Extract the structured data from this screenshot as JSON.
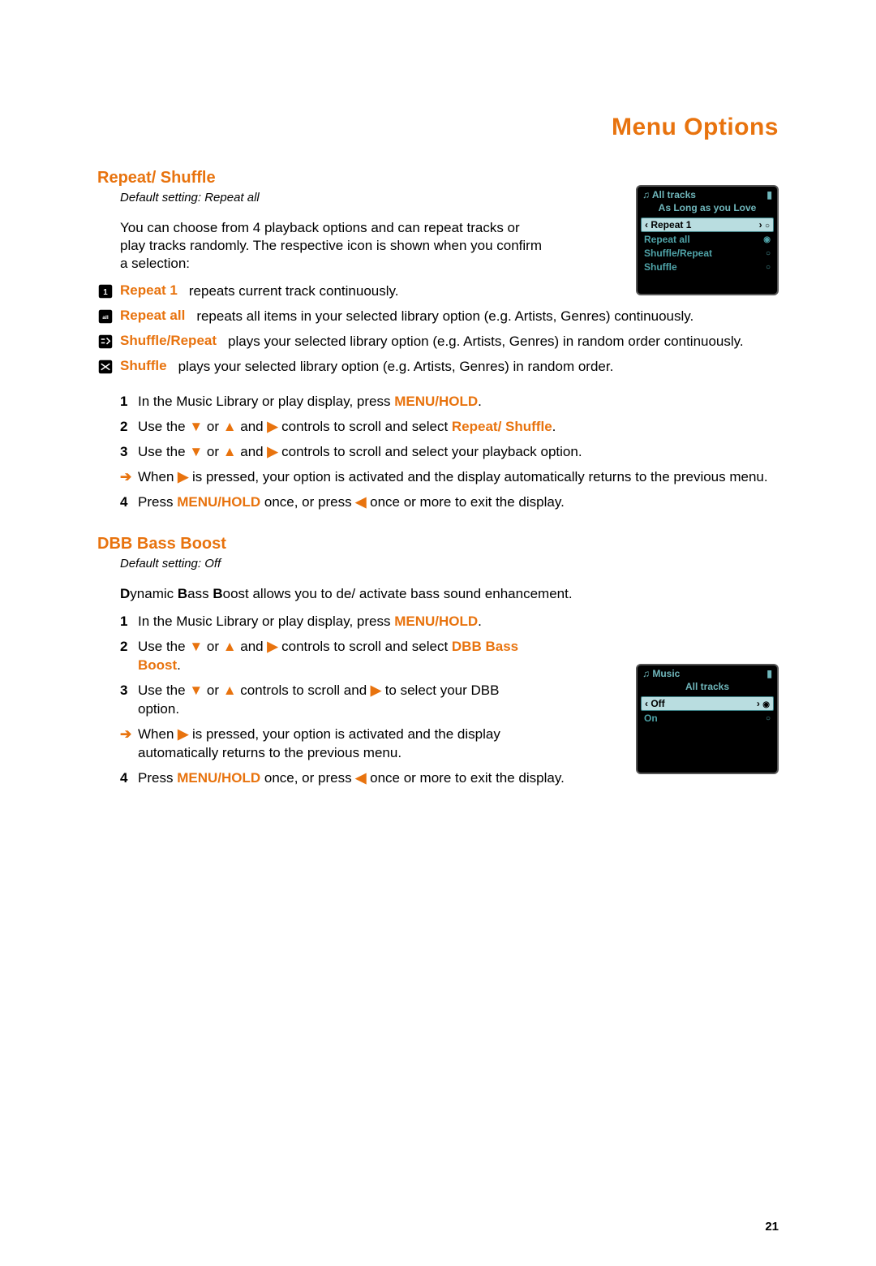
{
  "page_title": "Menu Options",
  "page_number": "21",
  "repeat_shuffle": {
    "heading": "Repeat/ Shuffle",
    "default_setting": "Default setting: Repeat all",
    "intro": "You can choose from 4 playback options and can repeat tracks or play tracks randomly. The respective icon is shown when you confirm a selection:",
    "options": {
      "repeat1_label": "Repeat 1",
      "repeat1_desc": "repeats current track continuously.",
      "repeatall_label": "Repeat all",
      "repeatall_desc": "repeats all items in your selected library option (e.g. Artists, Genres) continuously.",
      "shufrep_label": "Shuffle/Repeat",
      "shufrep_desc": "plays your selected library option (e.g. Artists, Genres) in random order continuously.",
      "shuffle_label": "Shuffle",
      "shuffle_desc": "plays your selected library option (e.g. Artists, Genres) in random order."
    },
    "steps": {
      "s1_pre": "In the Music Library or play display, press ",
      "s1_cmd": "MENU/HOLD",
      "s1_post": ".",
      "s2_pre": "Use the ",
      "s2_mid1": " or ",
      "s2_mid2": " and ",
      "s2_mid3": " controls to scroll and select ",
      "s2_target": "Repeat/ Shuffle",
      "s2_post": ".",
      "s3_pre": "Use the ",
      "s3_mid1": " or ",
      "s3_mid2": " and ",
      "s3_post": " controls to scroll and select your playback option.",
      "note_pre": "When ",
      "note_post": " is pressed, your option is activated and the display automatically returns to the previous menu.",
      "s4_pre": "Press ",
      "s4_cmd": "MENU/HOLD",
      "s4_mid": " once, or press ",
      "s4_post": " once or more to exit the display."
    },
    "device": {
      "topbar": "All tracks",
      "subtitle": "As Long as you Love",
      "items": [
        "Repeat 1",
        "Repeat all",
        "Shuffle/Repeat",
        "Shuffle"
      ]
    }
  },
  "dbb": {
    "heading": "DBB Bass Boost",
    "default_setting": "Default setting: Off",
    "intro_pre": "",
    "intro_bold_D": "D",
    "intro_seg1": "ynamic ",
    "intro_bold_B1": "B",
    "intro_seg2": "ass ",
    "intro_bold_B2": "B",
    "intro_seg3": "oost allows you to de/ activate bass sound enhancement.",
    "steps": {
      "s1_pre": "In the Music Library or play display, press ",
      "s1_cmd": "MENU/HOLD",
      "s1_post": ".",
      "s2_pre": "Use the ",
      "s2_mid1": " or ",
      "s2_mid2": " and ",
      "s2_mid3": " controls to scroll and select ",
      "s2_target": "DBB Bass Boost",
      "s2_post": ".",
      "s3_pre": "Use the ",
      "s3_mid1": " or ",
      "s3_mid2": " controls to scroll and ",
      "s3_post": " to select your DBB option.",
      "note_pre": "When ",
      "note_post": " is pressed, your option is activated and the display automatically returns to the previous menu.",
      "s4_pre": "Press ",
      "s4_cmd": "MENU/HOLD",
      "s4_mid": " once, or press ",
      "s4_post": " once or more to exit the display."
    },
    "device": {
      "topbar": "Music",
      "subtitle": "All tracks",
      "items": [
        "Off",
        "On"
      ]
    }
  },
  "glyphs": {
    "down": "▼",
    "up": "▲",
    "right": "▶",
    "left": "◀",
    "arrow": "➔",
    "note": "♫",
    "batt": "▮",
    "radio_sel": "◉",
    "radio": "○",
    "chev_l": "‹",
    "chev_r": "›"
  }
}
